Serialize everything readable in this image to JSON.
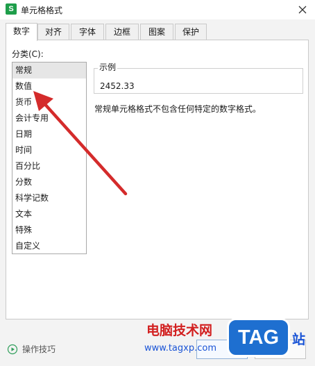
{
  "window": {
    "app_icon_letter": "S",
    "title": "单元格格式"
  },
  "tabs": [
    {
      "label": "数字",
      "active": true
    },
    {
      "label": "对齐",
      "active": false
    },
    {
      "label": "字体",
      "active": false
    },
    {
      "label": "边框",
      "active": false
    },
    {
      "label": "图案",
      "active": false
    },
    {
      "label": "保护",
      "active": false
    }
  ],
  "category": {
    "label": "分类(C):",
    "items": [
      "常规",
      "数值",
      "货币",
      "会计专用",
      "日期",
      "时间",
      "百分比",
      "分数",
      "科学记数",
      "文本",
      "特殊",
      "自定义"
    ],
    "selected": "常规"
  },
  "sample": {
    "legend": "示例",
    "value": "2452.33"
  },
  "description": "常规单元格格式不包含任何特定的数字格式。",
  "footer": {
    "tips_label": "操作技巧"
  },
  "watermark": {
    "text": "电脑技术网",
    "url": "www.tagxp.com",
    "tag": "TAG",
    "suffix": "站"
  },
  "colors": {
    "annotation_arrow": "#d42b2b",
    "app_icon": "#1e9e4a",
    "watermark_red": "#d21f1f",
    "watermark_blue": "#1a54d6"
  }
}
